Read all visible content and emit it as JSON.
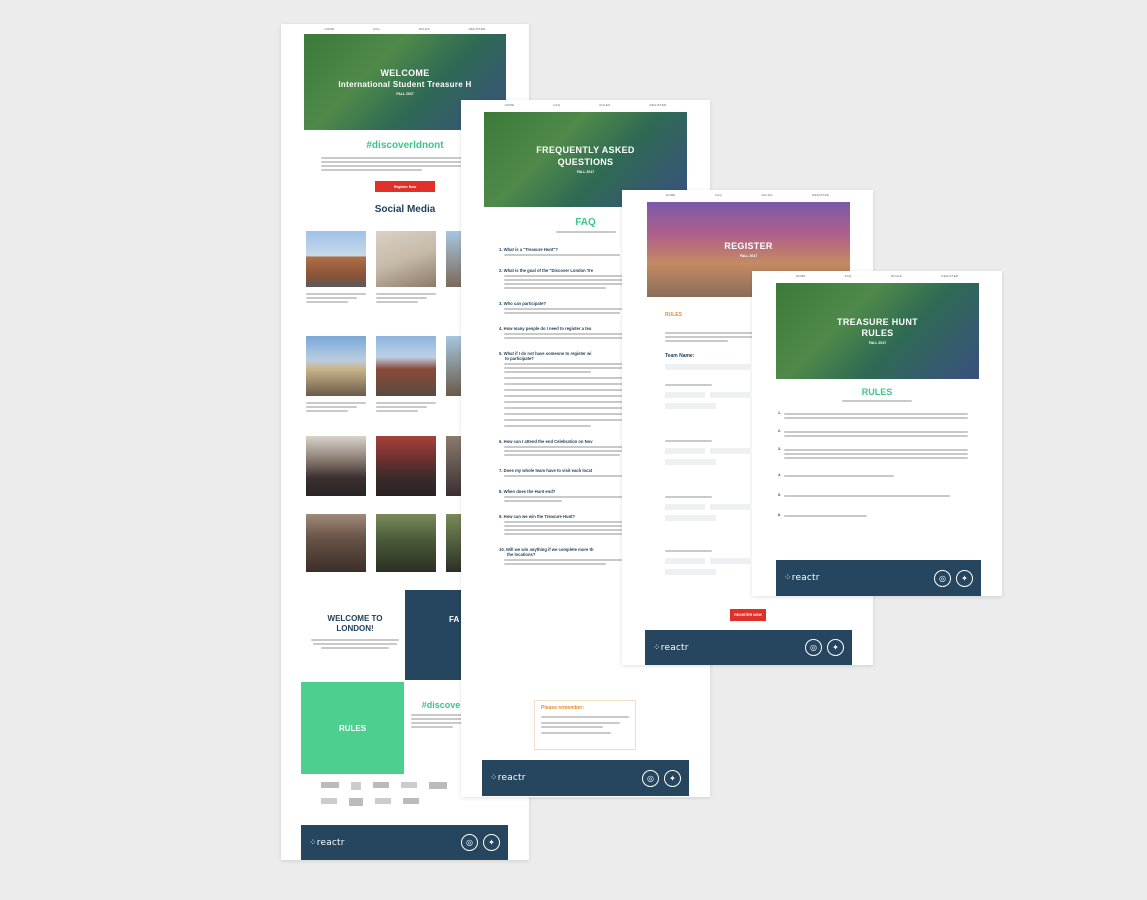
{
  "welcome_page": {
    "nav": [
      "HOME",
      "FAQ",
      "RULES",
      "REGISTER"
    ],
    "hero_title_1": "WELCOME",
    "hero_title_2": "International Student Treasure H",
    "hero_subtitle": "FALL 2017",
    "hashtag": "#discoverldnont",
    "register_button": "Register Now",
    "social_heading": "Social Media",
    "welcome_block": "WELCOME TO LONDON!",
    "faq_block": "FA",
    "rules_block": "RULES",
    "hashtag_2": "#discove"
  },
  "faq_page": {
    "nav": [
      "HOME",
      "FAQ",
      "RULES",
      "REGISTER"
    ],
    "hero_title_1": "FREQUENTLY ASKED",
    "hero_title_2": "QUESTIONS",
    "hero_subtitle": "FALL 2017",
    "heading": "FAQ",
    "questions": [
      {
        "num": "1.",
        "text": "What is a \"Treasure Hunt\"?"
      },
      {
        "num": "2.",
        "text": "What is the goal of the \"Discover London Tre"
      },
      {
        "num": "3.",
        "text": "Who can participate?"
      },
      {
        "num": "4.",
        "text": "How many people do I need to register a tea"
      },
      {
        "num": "5.",
        "text": "What if I do not have someone to register wi"
      },
      {
        "num": "6.",
        "text": "How can I attend the end Celebration on Nov"
      },
      {
        "num": "7.",
        "text": "Does my whole team have to visit each locat"
      },
      {
        "num": "8.",
        "text": "When does the Hunt end?"
      },
      {
        "num": "9.",
        "text": "How can we win the Treasure Hunt?"
      },
      {
        "num": "10.",
        "text": "Will we win anything if we complete more th"
      }
    ],
    "q5_cont": "to participate?",
    "q10_cont": "the locations?",
    "remember_heading": "Please remember:"
  },
  "register_page": {
    "nav": [
      "HOME",
      "FAQ",
      "RULES",
      "REGISTER"
    ],
    "hero_title": "REGISTER",
    "hero_subtitle": "FALL 2017",
    "rules_heading": "RULES",
    "team_name_label": "Team Name:",
    "register_button": "REGISTER NOW"
  },
  "rules_page": {
    "nav": [
      "HOME",
      "FAQ",
      "RULES",
      "REGISTER"
    ],
    "hero_title_1": "TREASURE HUNT",
    "hero_title_2": "RULES",
    "hero_subtitle": "FALL 2017",
    "heading": "RULES",
    "items": [
      "1.",
      "2.",
      "3.",
      "4.",
      "5.",
      "6."
    ]
  },
  "brand": {
    "logo": "reactr",
    "instagram_glyph": "◎",
    "twitter_glyph": "🐦"
  },
  "colors": {
    "navy": "#25465e",
    "green": "#3cc48a",
    "red": "#e0302a",
    "orange": "#e88a2a",
    "background": "#ececec"
  }
}
